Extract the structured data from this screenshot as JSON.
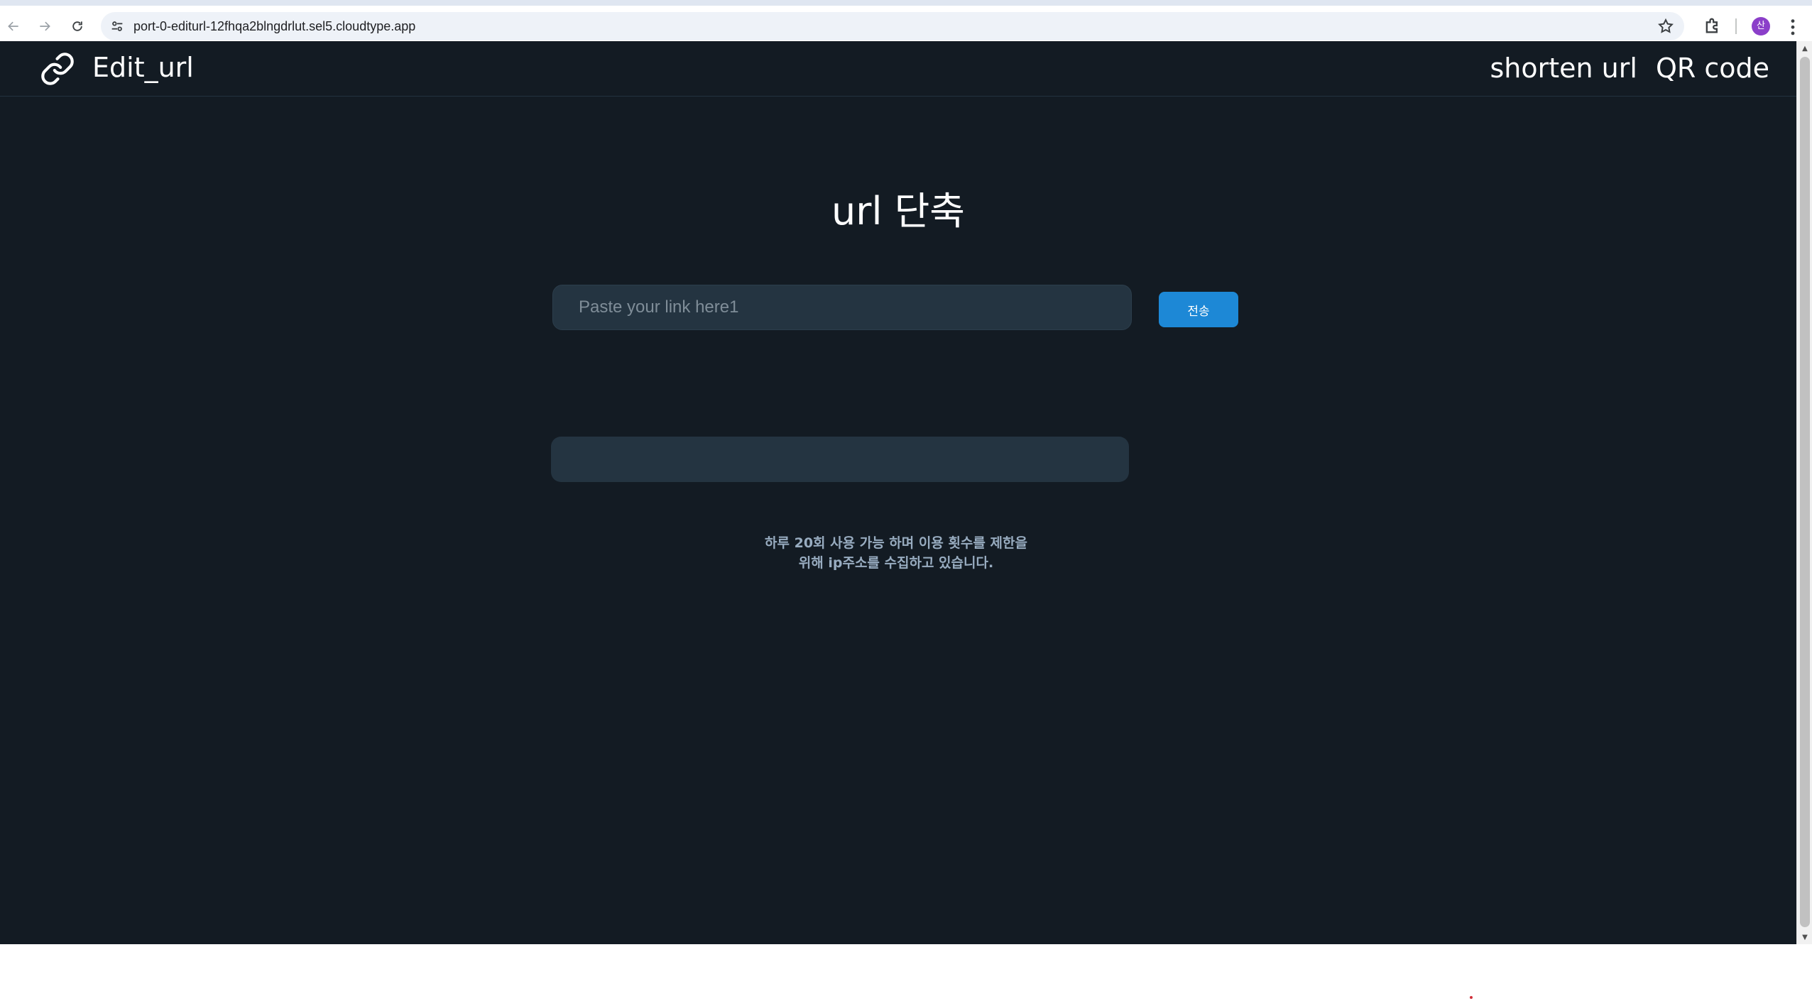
{
  "browser": {
    "url": "port-0-editurl-12fhqa2blngdrlut.sel5.cloudtype.app",
    "profile_initial": "산"
  },
  "header": {
    "brand_title": "Edit_url",
    "nav": [
      {
        "label": "shorten url"
      },
      {
        "label": "QR code"
      }
    ]
  },
  "main": {
    "heading": "url 단축",
    "input": {
      "placeholder": "Paste your link here1",
      "value": ""
    },
    "submit_label": "전송",
    "result_value": "",
    "notice_lines": [
      "하루 20회 사용 가능 하며 이용 횟수를 제한을",
      "위해 ip주소를 수집하고 있습니다."
    ]
  },
  "colors": {
    "page_background": "#131b23",
    "input_background": "#243441",
    "button_accent": "#1d88d6",
    "notice_text": "#98acc0"
  },
  "icons": [
    "back-icon",
    "forward-icon",
    "reload-icon",
    "site-info-icon",
    "bookmark-star-icon",
    "extensions-icon",
    "more-menu-icon",
    "link-logo-icon"
  ]
}
